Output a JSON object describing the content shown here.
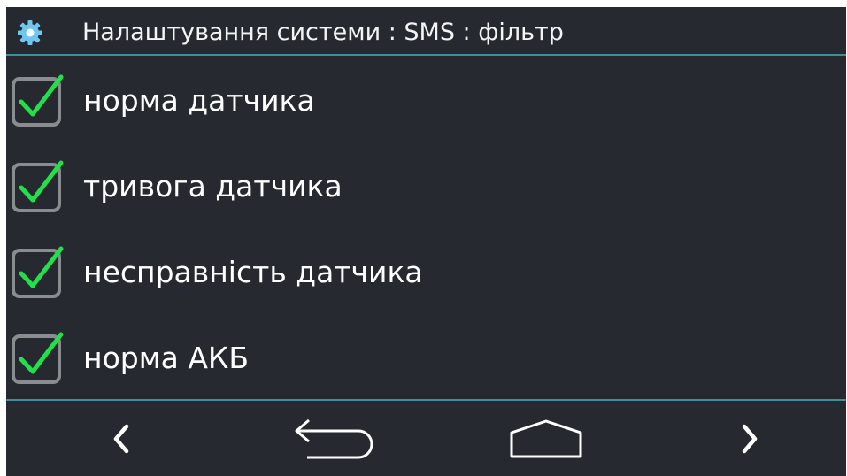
{
  "header": {
    "title": "Налаштування системи : SMS : фільтр",
    "icon": "gear-icon"
  },
  "filters": [
    {
      "label": "норма датчика",
      "checked": true
    },
    {
      "label": "тривога датчика",
      "checked": true
    },
    {
      "label": "несправність датчика",
      "checked": true
    },
    {
      "label": "норма АКБ",
      "checked": true
    }
  ],
  "navbar": {
    "icons": [
      "chevron-left-icon",
      "back-arrow-icon",
      "home-icon",
      "chevron-right-icon"
    ]
  },
  "colors": {
    "background": "#262a30",
    "accent_line": "#3d8f9c",
    "check": "#22e04a",
    "checkbox_border": "#8a8d90",
    "gear": "#6fc6ee"
  }
}
